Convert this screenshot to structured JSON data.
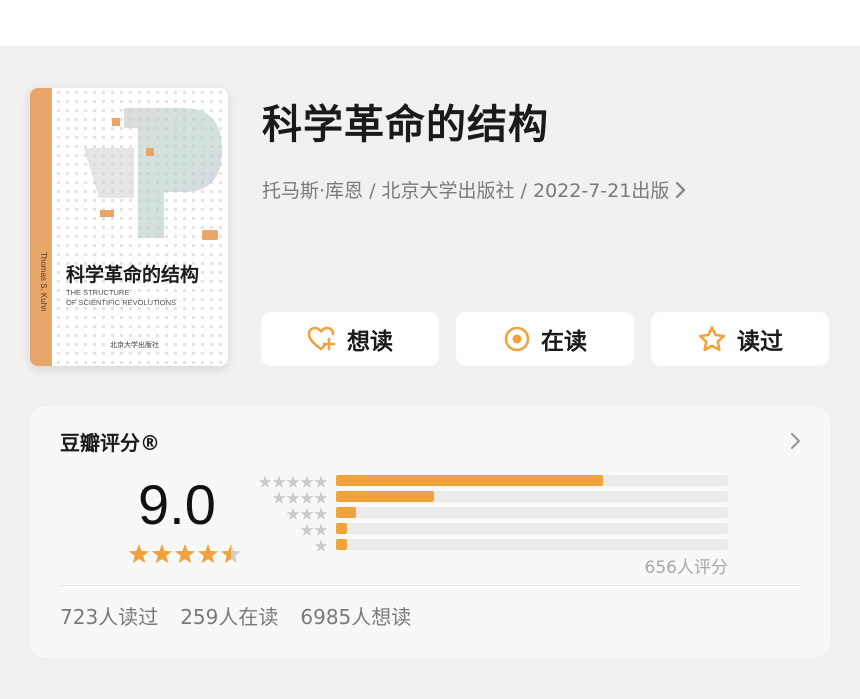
{
  "book": {
    "title": "科学革命的结构",
    "meta": "托马斯·库恩 / 北京大学出版社 / 2022-7-21出版",
    "cover": {
      "title": "科学革命的结构",
      "subtitle_line1": "THE STRUCTURE",
      "subtitle_line2": "OF SCIENTIFIC REVOLUTIONS",
      "author_spine": "Thomas S. Kuhn",
      "publisher": "北京大学出版社"
    }
  },
  "actions": [
    {
      "label": "想读",
      "icon": "heart-plus-icon"
    },
    {
      "label": "在读",
      "icon": "target-circle-icon"
    },
    {
      "label": "读过",
      "icon": "star-outline-icon"
    }
  ],
  "rating": {
    "title": "豆瓣评分®",
    "score": "9.0",
    "score_stars": 4.5,
    "distribution": [
      {
        "stars": 5,
        "fraction": 0.68
      },
      {
        "stars": 4,
        "fraction": 0.25
      },
      {
        "stars": 3,
        "fraction": 0.05
      },
      {
        "stars": 2,
        "fraction": 0.02
      },
      {
        "stars": 1,
        "fraction": 0.02
      }
    ],
    "count": "656人评分",
    "stats": {
      "read": "723人读过",
      "reading": "259人在读",
      "want": "6985人想读"
    }
  },
  "colors": {
    "accent": "#f0a33d",
    "background": "#f2f1ef",
    "card": "#ffffff",
    "muted_text": "#7a7a7a"
  }
}
